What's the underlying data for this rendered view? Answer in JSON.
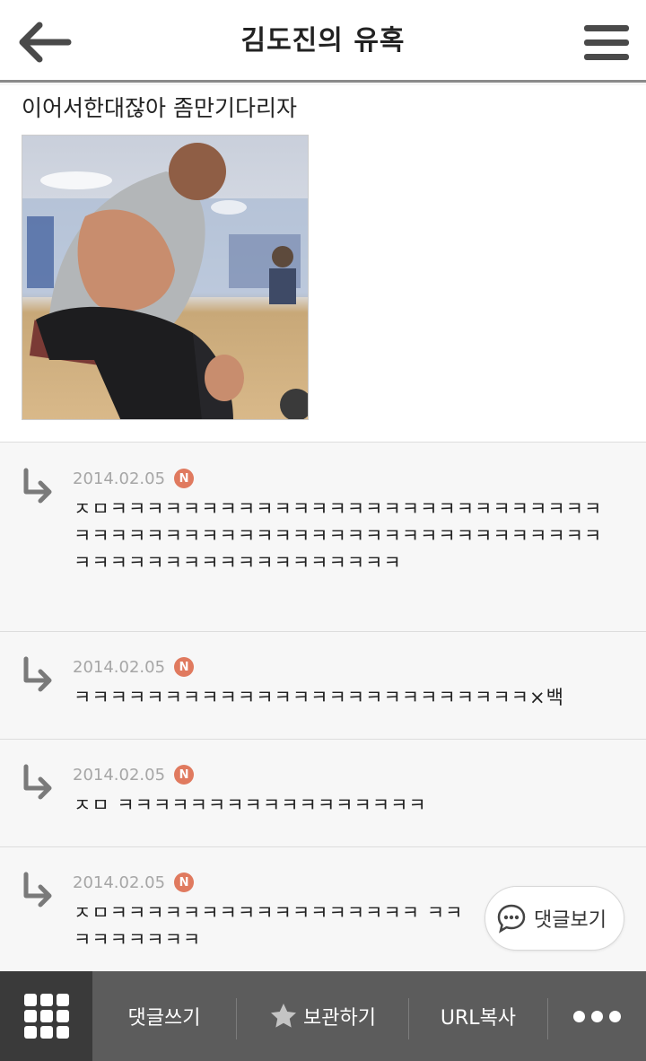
{
  "header": {
    "title": "김도진의 유혹",
    "back_icon": "back-arrow-icon",
    "menu_icon": "hamburger-menu-icon"
  },
  "post": {
    "text": "이어서한대잖아 좀만기다리자",
    "image_alt": "photo"
  },
  "comments": [
    {
      "date": "2014.02.05",
      "badge": "N",
      "text": "ㅈㅁㅋㅋㅋㅋㅋㅋㅋㅋㅋㅋㅋㅋㅋㅋㅋㅋㅋㅋㅋㅋㅋㅋㅋㅋㅋㅋㅋㅋㅋㅋㅋㅋㅋㅋㅋㅋㅋㅋㅋㅋㅋㅋㅋㅋㅋㅋㅋㅋㅋㅋㅋㅋㅋㅋㅋㅋㅋㅋㅋㅋㅋㅋㅋㅋㅋㅋㅋㅋㅋㅋㅋㅋㅋㅋ"
    },
    {
      "date": "2014.02.05",
      "badge": "N",
      "text": "ㅋㅋㅋㅋㅋㅋㅋㅋㅋㅋㅋㅋㅋㅋㅋㅋㅋㅋㅋㅋㅋㅋㅋㅋㅋ×백"
    },
    {
      "date": "2014.02.05",
      "badge": "N",
      "text": "ㅈㅁ ㅋㅋㅋㅋㅋㅋㅋㅋㅋㅋㅋㅋㅋㅋㅋㅋㅋ"
    },
    {
      "date": "2014.02.05",
      "badge": "N",
      "text": "ㅈㅁㅋㅋㅋㅋㅋㅋㅋㅋㅋㅋㅋㅋㅋㅋㅋㅋㅋ ㅋㅋㅋㅋㅋㅋㅋㅋㅋ"
    }
  ],
  "float_button": {
    "label": "댓글보기",
    "icon": "chat-bubble-icon"
  },
  "tabbar": {
    "grid_icon": "grid-menu-icon",
    "write_comment": "댓글쓰기",
    "save_label": "보관하기",
    "save_icon": "star-icon",
    "copy_url": "URL복사",
    "more_icon": "more-dots-icon"
  },
  "colors": {
    "badge": "#e07a5f",
    "tabbar": "#5c5c5c",
    "tabbar_active": "#3a3a3a"
  }
}
